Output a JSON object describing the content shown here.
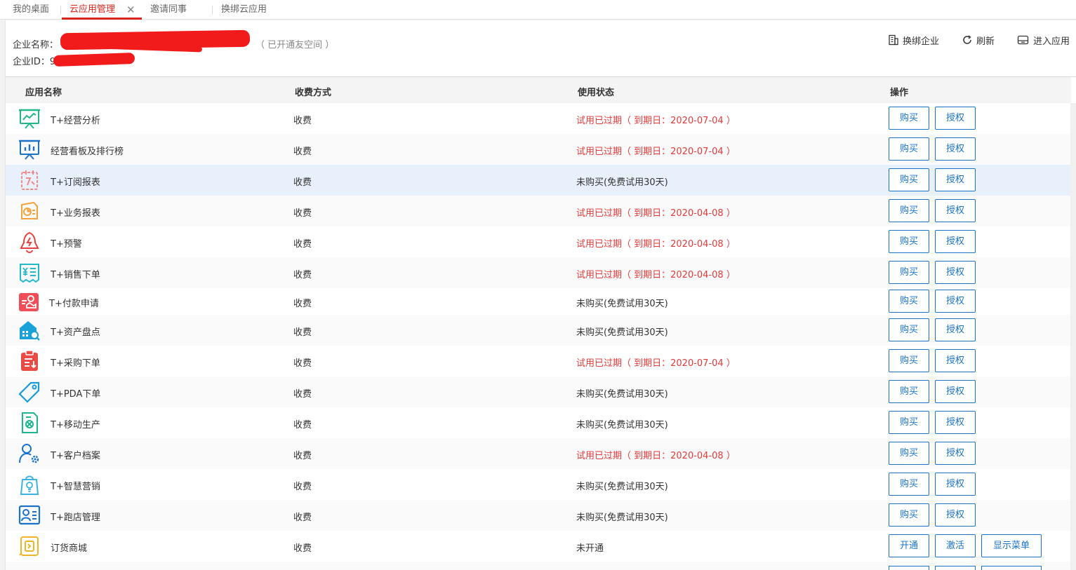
{
  "tabs": [
    {
      "label": "我的桌面",
      "active": false
    },
    {
      "label": "云应用管理",
      "active": true,
      "closable": true
    },
    {
      "label": "邀请同事",
      "active": false
    },
    {
      "label": "换绑云应用",
      "active": false
    }
  ],
  "close_glyph": "✕",
  "company": {
    "name_label": "企业名称：",
    "id_label": "企业ID：",
    "id_prefix": "9",
    "space_note": "（ 已开通友空间 ）"
  },
  "actions": {
    "rebind": "换绑企业",
    "refresh": "刷新",
    "enter": "进入应用"
  },
  "table": {
    "headers": {
      "name": "应用名称",
      "fee": "收费方式",
      "status": "使用状态",
      "ops": "操作"
    },
    "rows": [
      {
        "name": "T+经营分析",
        "icon": "presentation-chart-icon",
        "fee": "收费",
        "status": "试用已过期（ 到期日：2020-07-04 ）",
        "expired": true,
        "buttons": [
          "购买",
          "授权"
        ]
      },
      {
        "name": "经营看板及排行榜",
        "icon": "dashboard-board-icon",
        "fee": "收费",
        "status": "试用已过期（ 到期日：2020-07-04 ）",
        "expired": true,
        "buttons": [
          "购买",
          "授权"
        ]
      },
      {
        "name": "T+订阅报表",
        "icon": "subscription-report-icon",
        "fee": "收费",
        "status": "未购买(免费试用30天)",
        "expired": false,
        "buttons": [
          "购买",
          "授权"
        ]
      },
      {
        "name": "T+业务报表",
        "icon": "business-report-icon",
        "fee": "收费",
        "status": "试用已过期（ 到期日：2020-04-08 ）",
        "expired": true,
        "buttons": [
          "购买",
          "授权"
        ]
      },
      {
        "name": "T+预警",
        "icon": "alert-bell-icon",
        "fee": "收费",
        "status": "试用已过期（ 到期日：2020-04-08 ）",
        "expired": true,
        "buttons": [
          "购买",
          "授权"
        ]
      },
      {
        "name": "T+销售下单",
        "icon": "sales-order-icon",
        "fee": "收费",
        "status": "试用已过期（ 到期日：2020-04-08 ）",
        "expired": true,
        "buttons": [
          "购买",
          "授权"
        ]
      },
      {
        "name": "T+付款申请",
        "icon": "payment-request-icon",
        "fee": "收费",
        "status": "未购买(免费试用30天)",
        "expired": false,
        "buttons": [
          "购买",
          "授权"
        ]
      },
      {
        "name": "T+资产盘点",
        "icon": "asset-inventory-icon",
        "fee": "收费",
        "status": "未购买(免费试用30天)",
        "expired": false,
        "buttons": [
          "购买",
          "授权"
        ]
      },
      {
        "name": "T+采购下单",
        "icon": "purchase-order-icon",
        "fee": "收费",
        "status": "试用已过期（ 到期日：2020-07-04 ）",
        "expired": true,
        "buttons": [
          "购买",
          "授权"
        ]
      },
      {
        "name": "T+PDA下单",
        "icon": "pda-tag-icon",
        "fee": "收费",
        "status": "未购买(免费试用30天)",
        "expired": false,
        "buttons": [
          "购买",
          "授权"
        ]
      },
      {
        "name": "T+移动生产",
        "icon": "mobile-production-icon",
        "fee": "收费",
        "status": "未购买(免费试用30天)",
        "expired": false,
        "buttons": [
          "购买",
          "授权"
        ]
      },
      {
        "name": "T+客户档案",
        "icon": "customer-profile-icon",
        "fee": "收费",
        "status": "试用已过期（ 到期日：2020-04-08 ）",
        "expired": true,
        "buttons": [
          "购买",
          "授权"
        ]
      },
      {
        "name": "T+智慧营销",
        "icon": "smart-marketing-icon",
        "fee": "收费",
        "status": "未购买(免费试用30天)",
        "expired": false,
        "buttons": [
          "购买",
          "授权"
        ]
      },
      {
        "name": "T+跑店管理",
        "icon": "store-visit-icon",
        "fee": "收费",
        "status": "未购买(免费试用30天)",
        "expired": false,
        "buttons": [
          "购买",
          "授权"
        ]
      },
      {
        "name": "订货商城",
        "icon": "order-mall-icon",
        "fee": "收费",
        "status": "未开通",
        "expired": false,
        "buttons": [
          "开通",
          "激活",
          "显示菜单"
        ]
      }
    ]
  },
  "colors": {
    "accent": "#d9261c",
    "expired": "#e43a3a",
    "button": "#1a73c7",
    "highlight_row": "#e8f1fb"
  }
}
